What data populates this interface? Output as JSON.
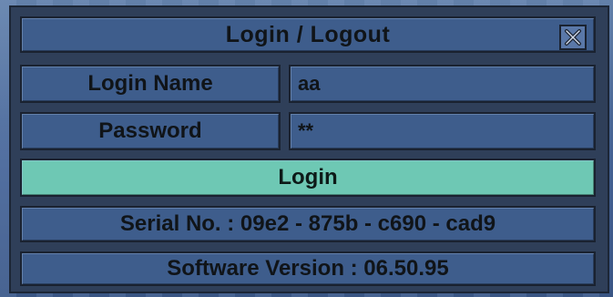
{
  "dialog": {
    "title": "Login / Logout",
    "close_icon": "close-icon"
  },
  "form": {
    "login_name_label": "Login Name",
    "login_name_value": "aa",
    "password_label": "Password",
    "password_value": "**",
    "login_button": "Login"
  },
  "info": {
    "serial": "Serial No. : 09e2 - 875b - c690 - cad9",
    "software_version": "Software Version : 06.50.95"
  },
  "colors": {
    "panel_cell": "#4060a0",
    "login_button": "#6ec8b4",
    "text": "#101418"
  }
}
